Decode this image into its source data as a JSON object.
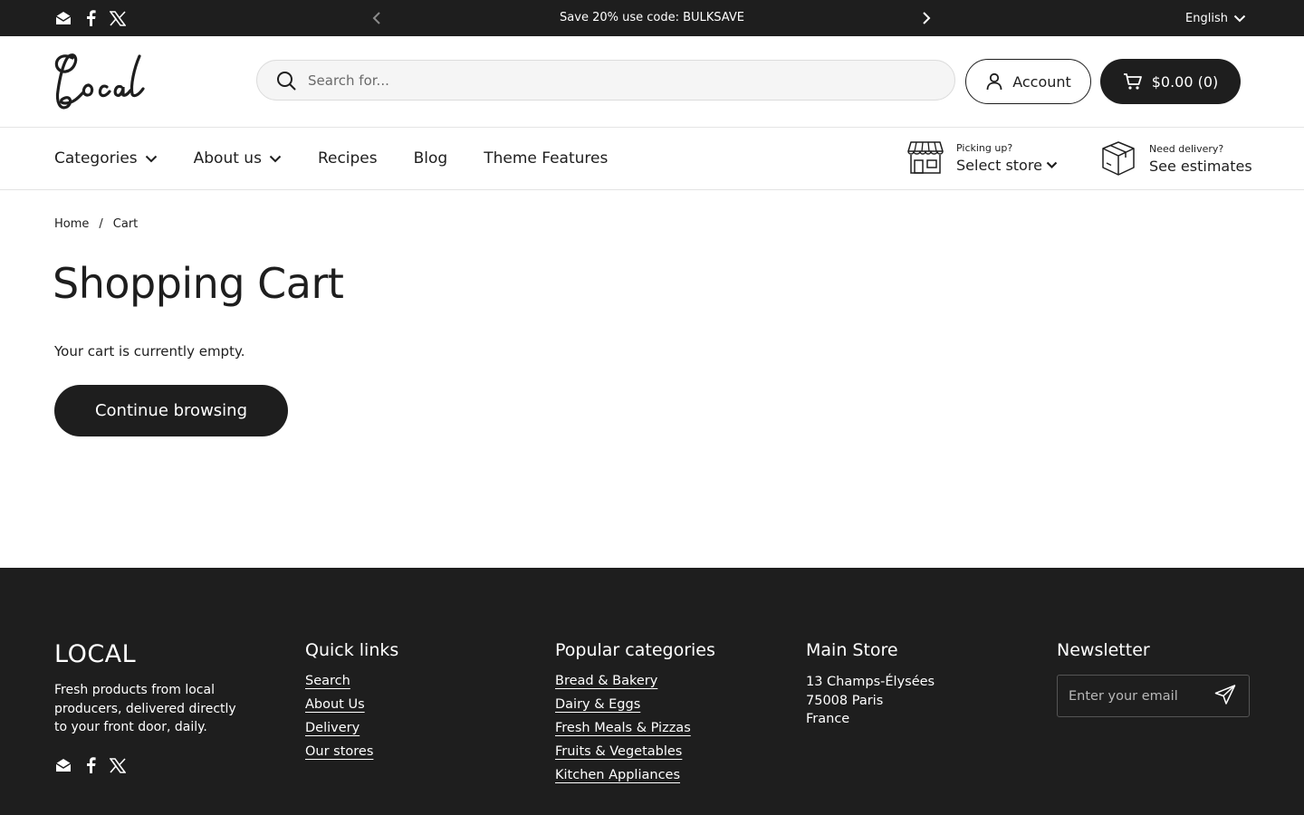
{
  "topbar": {
    "announcement": "Save 20% use code: BULKSAVE",
    "language": "English",
    "socials": [
      "email-icon",
      "facebook-icon",
      "x-icon"
    ]
  },
  "header": {
    "logo_text": "Local",
    "search_placeholder": "Search for...",
    "account_label": "Account",
    "cart_label": "$0.00 (0)"
  },
  "nav": {
    "items": [
      {
        "label": "Categories",
        "dropdown": true
      },
      {
        "label": "About us",
        "dropdown": true
      },
      {
        "label": "Recipes",
        "dropdown": false
      },
      {
        "label": "Blog",
        "dropdown": false
      },
      {
        "label": "Theme Features",
        "dropdown": false
      }
    ],
    "pickup": {
      "small": "Picking up?",
      "big": "Select store"
    },
    "delivery": {
      "small": "Need delivery?",
      "big": "See estimates"
    }
  },
  "breadcrumb": {
    "home": "Home",
    "separator": "/",
    "current": "Cart"
  },
  "main": {
    "title": "Shopping Cart",
    "empty_text": "Your cart is currently empty.",
    "continue_label": "Continue browsing"
  },
  "footer": {
    "brand": "LOCAL",
    "tagline": "Fresh products from local producers, delivered directly to your front door, daily.",
    "quick_links": {
      "title": "Quick links",
      "links": [
        "Search",
        "About Us",
        "Delivery",
        "Our stores"
      ]
    },
    "popular": {
      "title": "Popular categories",
      "links": [
        "Bread & Bakery",
        "Dairy & Eggs",
        "Fresh Meals & Pizzas",
        "Fruits & Vegetables",
        "Kitchen Appliances"
      ]
    },
    "store": {
      "title": "Main Store",
      "lines": [
        "13 Champs-Élysées",
        "75008 Paris",
        "France"
      ]
    },
    "newsletter": {
      "title": "Newsletter",
      "placeholder": "Enter your email"
    }
  },
  "colors": {
    "dark": "#1e1e1e",
    "light": "#ffffff",
    "border": "#e4e4e4"
  }
}
